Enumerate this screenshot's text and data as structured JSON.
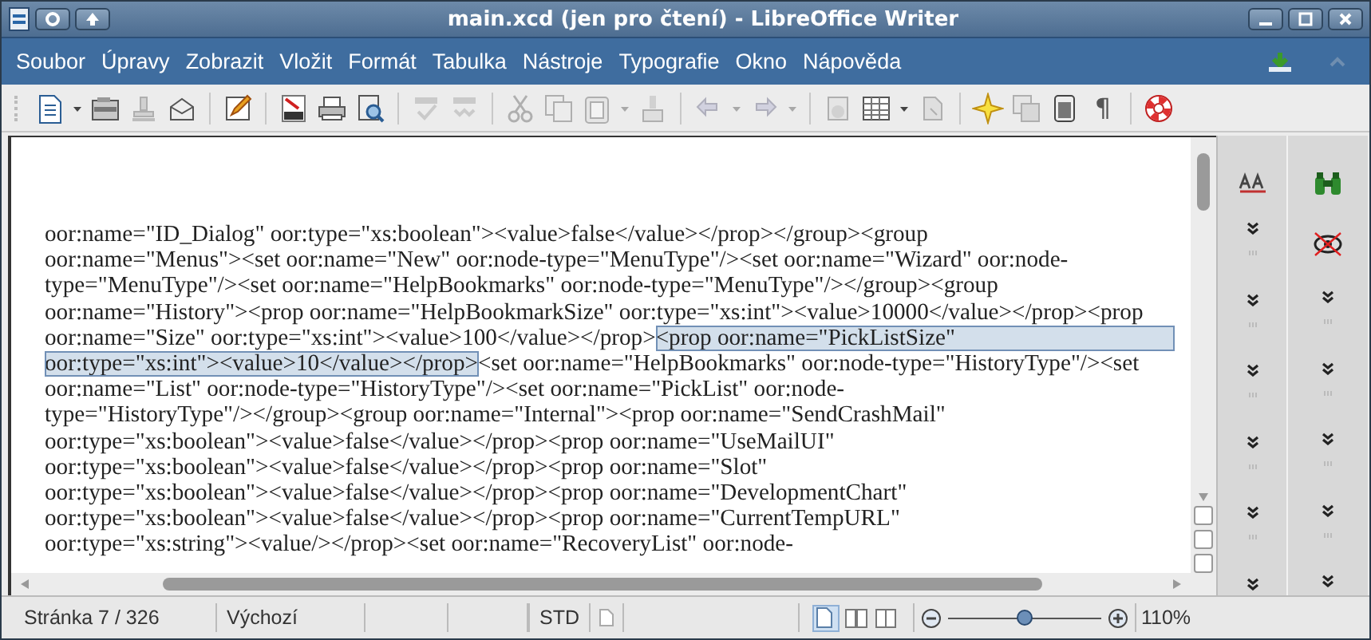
{
  "window": {
    "title": "main.xcd (jen pro čtení) - LibreOffice Writer"
  },
  "menu": [
    {
      "label": "Soubor"
    },
    {
      "label": "Úpravy"
    },
    {
      "label": "Zobrazit"
    },
    {
      "label": "Vložit"
    },
    {
      "label": "Formát"
    },
    {
      "label": "Tabulka"
    },
    {
      "label": "Nástroje"
    },
    {
      "label": "Typografie"
    },
    {
      "label": "Okno"
    },
    {
      "label": "Nápověda"
    }
  ],
  "toolbar": [
    {
      "kind": "button",
      "disabled": false
    },
    {
      "kind": "dropdown",
      "disabled": false
    },
    {
      "kind": "button",
      "disabled": false
    },
    {
      "kind": "button",
      "disabled": true
    },
    {
      "kind": "button",
      "disabled": false
    },
    {
      "kind": "separator"
    },
    {
      "kind": "button",
      "disabled": false
    },
    {
      "kind": "separator"
    },
    {
      "kind": "button",
      "disabled": false
    },
    {
      "kind": "button",
      "disabled": false
    },
    {
      "kind": "button",
      "disabled": false
    },
    {
      "kind": "separator"
    },
    {
      "kind": "button",
      "disabled": true
    },
    {
      "kind": "button",
      "disabled": true
    },
    {
      "kind": "separator"
    },
    {
      "kind": "button",
      "disabled": true
    },
    {
      "kind": "button",
      "disabled": true
    },
    {
      "kind": "button",
      "disabled": true
    },
    {
      "kind": "dropdown",
      "disabled": true
    },
    {
      "kind": "button",
      "disabled": true
    },
    {
      "kind": "separator"
    },
    {
      "kind": "button",
      "disabled": true
    },
    {
      "kind": "dropdown",
      "disabled": true
    },
    {
      "kind": "button",
      "disabled": true
    },
    {
      "kind": "dropdown",
      "disabled": true
    },
    {
      "kind": "separator"
    },
    {
      "kind": "button",
      "disabled": true
    },
    {
      "kind": "button",
      "disabled": false
    },
    {
      "kind": "dropdown",
      "disabled": false
    },
    {
      "kind": "button",
      "disabled": true
    },
    {
      "kind": "separator"
    },
    {
      "kind": "button",
      "disabled": false
    },
    {
      "kind": "button",
      "disabled": true
    },
    {
      "kind": "button",
      "disabled": false
    },
    {
      "kind": "glyph",
      "text": "¶",
      "disabled": false
    },
    {
      "kind": "separator"
    },
    {
      "kind": "button",
      "disabled": false
    }
  ],
  "document": {
    "lines": [
      [
        {
          "text": "oor:name=\"ID_Dialog\" oor:type=\"xs:boolean\"><value>false</value></prop></group><group",
          "selected": false
        }
      ],
      [
        {
          "text": "oor:name=\"Menus\"><set oor:name=\"New\" oor:node-type=\"MenuType\"/><set oor:name=\"Wizard\" oor:node-",
          "selected": false
        }
      ],
      [
        {
          "text": "type=\"MenuType\"/><set oor:name=\"HelpBookmarks\" oor:node-type=\"MenuType\"/></group><group",
          "selected": false
        }
      ],
      [
        {
          "text": "oor:name=\"History\"><prop oor:name=\"HelpBookmarkSize\" oor:type=\"xs:int\"><value>10000</value></prop><prop",
          "selected": false
        }
      ],
      [
        {
          "text": "oor:name=\"Size\" oor:type=\"xs:int\"><value>100</value></prop>",
          "selected": false
        },
        {
          "text": "<prop oor:name=\"PickListSize\"",
          "selected": true
        }
      ],
      [
        {
          "text": "oor:type=\"xs:int\"><value>10</value></prop>",
          "selected": true
        },
        {
          "text": "<set oor:name=\"HelpBookmarks\" oor:node-type=\"HistoryType\"/><set",
          "selected": false
        }
      ],
      [
        {
          "text": "oor:name=\"List\" oor:node-type=\"HistoryType\"/><set oor:name=\"PickList\" oor:node-",
          "selected": false
        }
      ],
      [
        {
          "text": "type=\"HistoryType\"/></group><group oor:name=\"Internal\"><prop oor:name=\"SendCrashMail\"",
          "selected": false
        }
      ],
      [
        {
          "text": "oor:type=\"xs:boolean\"><value>false</value></prop><prop oor:name=\"UseMailUI\"",
          "selected": false
        }
      ],
      [
        {
          "text": "oor:type=\"xs:boolean\"><value>false</value></prop><prop oor:name=\"Slot\"",
          "selected": false
        }
      ],
      [
        {
          "text": "oor:type=\"xs:boolean\"><value>false</value></prop><prop oor:name=\"DevelopmentChart\"",
          "selected": false
        }
      ],
      [
        {
          "text": "oor:type=\"xs:boolean\"><value>false</value></prop><prop oor:name=\"CurrentTempURL\"",
          "selected": false
        }
      ],
      [
        {
          "text": "oor:type=\"xs:string\"><value/></prop><set oor:name=\"RecoveryList\" oor:node-",
          "selected": false
        }
      ]
    ]
  },
  "status_bar": {
    "page": "Stránka 7 / 326",
    "page_style": "Výchozí",
    "selection_mode": "STD",
    "view_layouts": [
      {
        "selected": true
      },
      {
        "selected": false
      },
      {
        "selected": false
      }
    ],
    "zoom": {
      "level": 0.5,
      "reading": "110%"
    }
  }
}
